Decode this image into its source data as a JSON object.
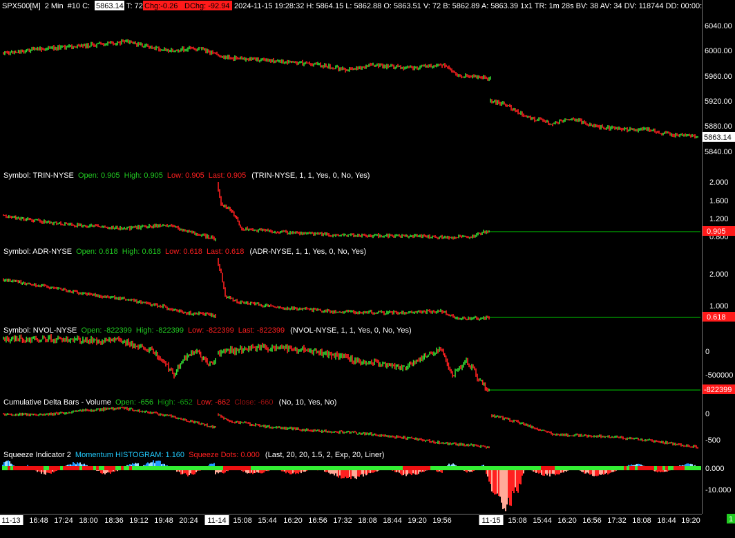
{
  "header": {
    "symbol": "SPX500[M]",
    "interval": "2 Min",
    "bars": "#10",
    "close_label": "C:",
    "close_value": "5863.14",
    "ticks_label": "T:",
    "ticks_value": "72",
    "chg_label": "Chg:",
    "chg_value": "-0.26",
    "dchg_label": "DChg:",
    "dchg_value": "-92.94",
    "datetime": "2024-11-15 19:28:32",
    "h": "H: 5864.15",
    "l": "L: 5862.88",
    "o": "O: 5863.51",
    "v": "V: 72",
    "b": "B: 5862.89",
    "a": "A: 5863.39",
    "bs": "1x1",
    "tr": "TR: 1m 28s",
    "bv": "BV: 38",
    "av": "AV: 34",
    "dv": "DV: 118744",
    "dd": "DD: 00:00:"
  },
  "panes": {
    "price": {
      "axis_labels": [
        "6040.00",
        "6000.00",
        "5960.00",
        "5920.00",
        "5880.00",
        "5840.00"
      ],
      "last_label": "5863.14"
    },
    "trin": {
      "symbol_label": "Symbol: TRIN-NYSE",
      "open": "Open: 0.905",
      "high": "High: 0.905",
      "low": "Low: 0.905",
      "last": "Last: 0.905",
      "params": "(TRIN-NYSE, 1, 1, Yes, 0, No, Yes)",
      "axis_labels": [
        "2.000",
        "1.600",
        "1.200",
        "0.800"
      ],
      "last_label": "0.905"
    },
    "adr": {
      "symbol_label": "Symbol: ADR-NYSE",
      "open": "Open: 0.618",
      "high": "High: 0.618",
      "low": "Low: 0.618",
      "last": "Last: 0.618",
      "params": "(ADR-NYSE, 1, 1, Yes, 0, No, Yes)",
      "axis_labels": [
        "2.000",
        "1.000"
      ],
      "last_label": "0.618"
    },
    "nvol": {
      "symbol_label": "Symbol: NVOL-NYSE",
      "open": "Open: -822399",
      "high": "High: -822399",
      "low": "Low: -822399",
      "last": "Last: -822399",
      "params": "(NVOL-NYSE, 1, 1, Yes, 0, No, Yes)",
      "axis_labels": [
        "0",
        "-500000"
      ],
      "last_label": "-822399"
    },
    "delta": {
      "title": "Cumulative Delta Bars - Volume",
      "open": "Open: -656",
      "high": "High: -652",
      "low": "Low: -662",
      "close": "Close: -660",
      "params": "(No, 10, Yes, No)",
      "axis_labels": [
        "0",
        "-500"
      ]
    },
    "squeeze": {
      "title": "Squeeze Indicator 2",
      "momentum": "Momentum HISTOGRAM: 1.160",
      "dots": "Squeeze Dots: 0.000",
      "params": "(Last, 20, 20, 1.5, 2, Exp, 20, Liner)",
      "axis_labels": [
        "0.000",
        "-10.000"
      ]
    }
  },
  "time_axis": {
    "labels": [
      "11-13",
      "16:48",
      "17:24",
      "18:00",
      "18:36",
      "19:12",
      "19:48",
      "20:24",
      "11-14",
      "15:08",
      "15:44",
      "16:20",
      "16:56",
      "17:32",
      "18:08",
      "18:44",
      "19:20",
      "19:56",
      "11-15",
      "15:08",
      "15:44",
      "16:20",
      "16:56",
      "17:32",
      "18:08",
      "18:44",
      "19:20"
    ],
    "highlighted": [
      "11-13",
      "11-14",
      "11-15"
    ]
  },
  "corner": {
    "label": "1"
  },
  "colors": {
    "up": "#33dd33",
    "down": "#ff2020",
    "label_green": "#22cc22",
    "label_red": "#ff2020",
    "label_cyan": "#22ccff",
    "level_line": "#00cc00",
    "squeeze_on": "#33ee33",
    "squeeze_off": "#ee1111",
    "hist_pos_strong": "#2299ff",
    "hist_pos_weak": "#99ddff",
    "hist_neg_strong": "#ff2020",
    "hist_neg_weak": "#ffaa99"
  }
}
